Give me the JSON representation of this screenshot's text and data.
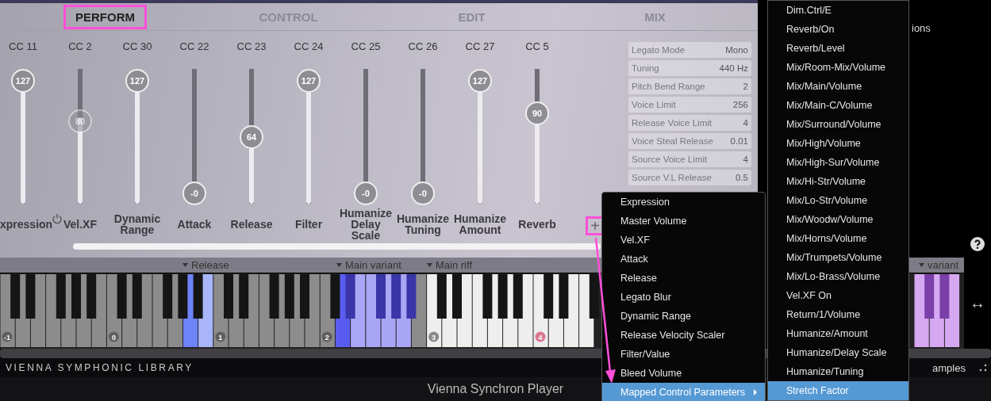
{
  "tabs": [
    {
      "label": "PERFORM",
      "selected": true
    },
    {
      "label": "CONTROL",
      "selected": false
    },
    {
      "label": "EDIT",
      "selected": false
    },
    {
      "label": "MIX",
      "selected": false
    }
  ],
  "sliders": [
    {
      "cc": "CC 11",
      "label": "xpression",
      "value": "127",
      "level": 1,
      "enabled": true,
      "power_button": false
    },
    {
      "cc": "CC 2",
      "label": "Vel.XF",
      "value": "80",
      "level": 0.64,
      "enabled": false,
      "power_button": true
    },
    {
      "cc": "CC 30",
      "label": "Dynamic Range",
      "value": "127",
      "level": 1,
      "enabled": true,
      "power_button": false
    },
    {
      "cc": "CC 22",
      "label": "Attack",
      "value": "-0",
      "level": 0,
      "enabled": true,
      "power_button": false
    },
    {
      "cc": "CC 23",
      "label": "Release",
      "value": "64",
      "level": 0.5,
      "enabled": true,
      "power_button": false
    },
    {
      "cc": "CC 24",
      "label": "Filter",
      "value": "127",
      "level": 1,
      "enabled": true,
      "power_button": false
    },
    {
      "cc": "CC 25",
      "label": "Humanize Delay Scale",
      "value": "-0",
      "level": 0,
      "enabled": true,
      "power_button": false
    },
    {
      "cc": "CC 26",
      "label": "Humanize Tuning",
      "value": "-0",
      "level": 0,
      "enabled": true,
      "power_button": false
    },
    {
      "cc": "CC 27",
      "label": "Humanize Amount",
      "value": "127",
      "level": 1,
      "enabled": true,
      "power_button": false
    },
    {
      "cc": "CC 5",
      "label": "Reverb",
      "value": "90",
      "level": 0.71,
      "enabled": true,
      "power_button": false
    }
  ],
  "plus_button": {
    "label": "+",
    "annotated": true
  },
  "parameters": [
    {
      "label": "Legato Mode",
      "value": "Mono"
    },
    {
      "label": "Tuning",
      "value": "440 Hz"
    },
    {
      "label": "Pitch Bend Range",
      "value": "2"
    },
    {
      "label": "Voice Limit",
      "value": "256"
    },
    {
      "label": "Release Voice Limit",
      "value": "4"
    },
    {
      "label": "Voice Steal Release",
      "value": "0.01"
    },
    {
      "label": "Source Voice Limit",
      "value": "4"
    },
    {
      "label": "Source V.L Release",
      "value": "0.5"
    }
  ],
  "background_texts": {
    "top": "ions",
    "bottom": "amples"
  },
  "zones": [
    {
      "label": "Release"
    },
    {
      "label": "Main variant"
    },
    {
      "label": "Main riff"
    },
    {
      "label": "variant"
    }
  ],
  "octaves": [
    {
      "label": "-1",
      "color": "#5f5f5f"
    },
    {
      "label": "0",
      "color": "#5f5f5f"
    },
    {
      "label": "1",
      "color": "#5f5f5f"
    },
    {
      "label": "2",
      "color": "#5f5f5f"
    },
    {
      "label": "3",
      "color": "#8a8a8a"
    },
    {
      "label": "4",
      "color": "#d9788f"
    }
  ],
  "resize_glyph": "↔",
  "brand": "VIENNA SYMPHONIC LIBRARY",
  "footer_title": "Vienna Synchron Player",
  "menu": [
    {
      "label": "Expression",
      "selected": false,
      "submenu": false
    },
    {
      "label": "Master Volume",
      "selected": false,
      "submenu": false
    },
    {
      "label": "Vel.XF",
      "selected": false,
      "submenu": false
    },
    {
      "label": "Attack",
      "selected": false,
      "submenu": false
    },
    {
      "label": "Release",
      "selected": false,
      "submenu": false
    },
    {
      "label": "Legato Blur",
      "selected": false,
      "submenu": false
    },
    {
      "label": "Dynamic Range",
      "selected": false,
      "submenu": false
    },
    {
      "label": "Release Velocity Scaler",
      "selected": false,
      "submenu": false
    },
    {
      "label": "Filter/Value",
      "selected": false,
      "submenu": false
    },
    {
      "label": "Bleed Volume",
      "selected": false,
      "submenu": false
    },
    {
      "label": "Mapped Control Parameters",
      "selected": true,
      "submenu": true
    }
  ],
  "submenu": [
    {
      "label": "Dim.Ctrl/E",
      "selected": false
    },
    {
      "label": "Reverb/On",
      "selected": false
    },
    {
      "label": "Reverb/Level",
      "selected": false
    },
    {
      "label": "Mix/Room-Mix/Volume",
      "selected": false
    },
    {
      "label": "Mix/Main/Volume",
      "selected": false
    },
    {
      "label": "Mix/Main-C/Volume",
      "selected": false
    },
    {
      "label": "Mix/Surround/Volume",
      "selected": false
    },
    {
      "label": "Mix/High/Volume",
      "selected": false
    },
    {
      "label": "Mix/High-Sur/Volume",
      "selected": false
    },
    {
      "label": "Mix/Hi-Str/Volume",
      "selected": false
    },
    {
      "label": "Mix/Lo-Str/Volume",
      "selected": false
    },
    {
      "label": "Mix/Woodw/Volume",
      "selected": false
    },
    {
      "label": "Mix/Horns/Volume",
      "selected": false
    },
    {
      "label": "Mix/Trumpets/Volume",
      "selected": false
    },
    {
      "label": "Mix/Lo-Brass/Volume",
      "selected": false
    },
    {
      "label": "Vel.XF On",
      "selected": false
    },
    {
      "label": "Return/1/Volume",
      "selected": false
    },
    {
      "label": "Humanize/Amount",
      "selected": false
    },
    {
      "label": "Humanize/Delay Scale",
      "selected": false
    },
    {
      "label": "Humanize/Tuning",
      "selected": false
    },
    {
      "label": "Stretch Factor",
      "selected": true
    }
  ]
}
